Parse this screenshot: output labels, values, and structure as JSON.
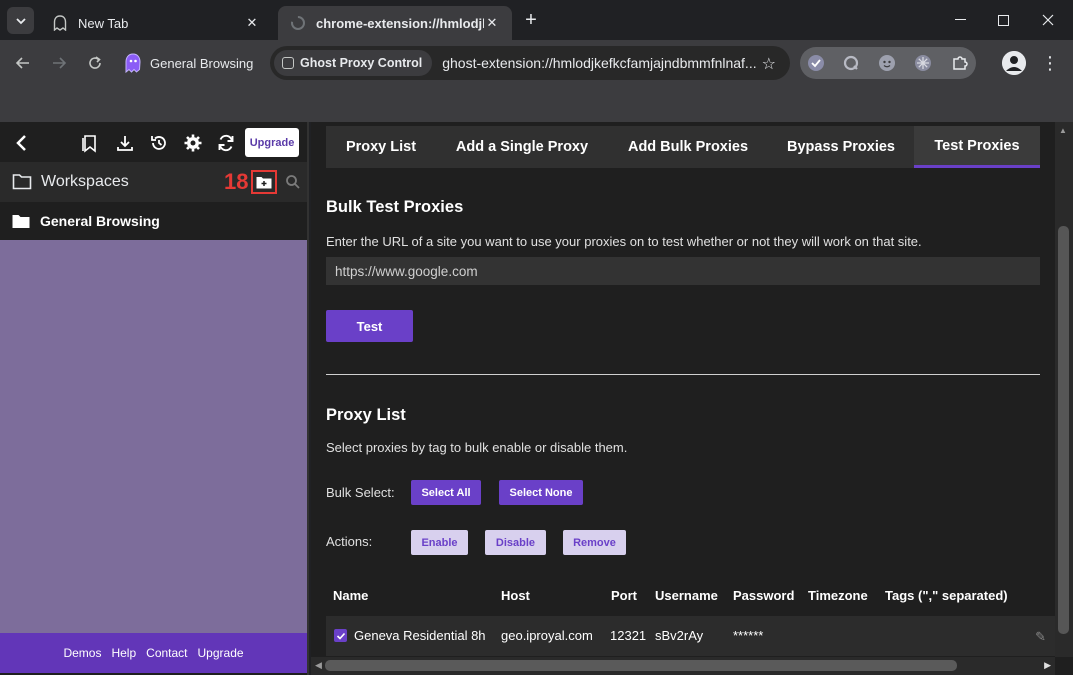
{
  "browser": {
    "tabs": [
      {
        "title": "New Tab",
        "active": false
      },
      {
        "title": "chrome-extension://hmlodjkc",
        "active": true
      }
    ],
    "profile_name": "General Browsing",
    "site_chip": "Ghost Proxy Control",
    "url": "ghost-extension://hmlodjkefkcfamjajndbmmfnlnaf..."
  },
  "sidebar": {
    "upgrade_label": "Upgrade",
    "workspaces_title": "Workspaces",
    "annotation_number": "18",
    "workspace_item": "General Browsing",
    "footer_links": [
      "Demos",
      "Help",
      "Contact",
      "Upgrade"
    ]
  },
  "main": {
    "tabs": [
      "Proxy List",
      "Add a Single Proxy",
      "Add Bulk Proxies",
      "Bypass Proxies",
      "Test Proxies"
    ],
    "active_tab": "Test Proxies",
    "bulk_test": {
      "title": "Bulk Test Proxies",
      "description": "Enter the URL of a site you want to use your proxies on to test whether or not they will work on that site.",
      "url_value": "https://www.google.com",
      "test_label": "Test"
    },
    "proxy_list": {
      "title": "Proxy List",
      "description": "Select proxies by tag to bulk enable or disable them.",
      "bulk_select_label": "Bulk Select:",
      "select_all": "Select All",
      "select_none": "Select None",
      "actions_label": "Actions:",
      "enable": "Enable",
      "disable": "Disable",
      "remove": "Remove",
      "columns": [
        "Name",
        "Host",
        "Port",
        "Username",
        "Password",
        "Timezone",
        "Tags (\",\" separated)"
      ],
      "rows": [
        {
          "checked": true,
          "name": "Geneva Residential 8h",
          "host": "geo.iproyal.com",
          "port": "12321",
          "username": "sBv2rAy",
          "password": "******",
          "timezone": "",
          "tags": ""
        }
      ]
    }
  },
  "colors": {
    "accent": "#6a40c8",
    "sidebar_footer": "#6236b8",
    "workspace_area": "#7d6d9b",
    "annotation_red": "#e53935"
  }
}
